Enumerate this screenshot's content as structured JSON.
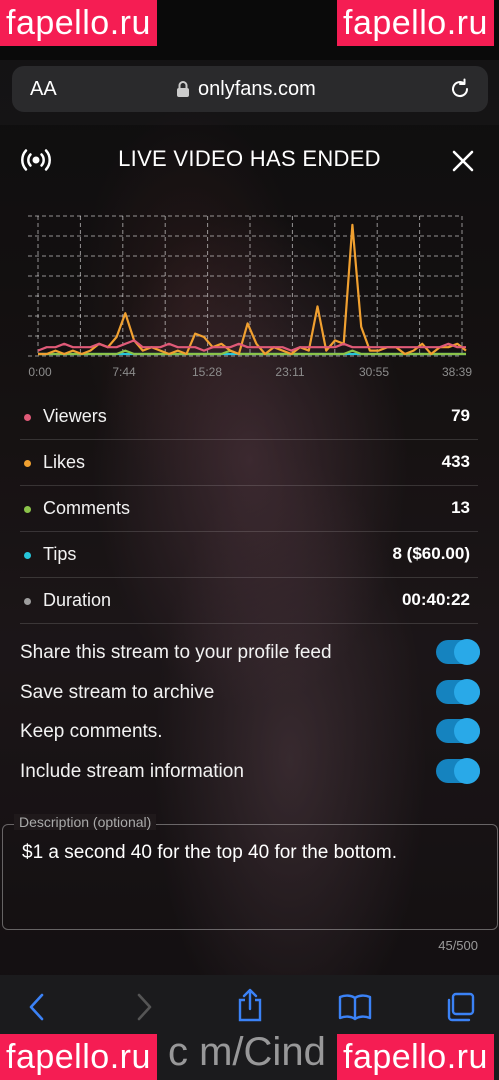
{
  "watermark": {
    "text": "fapello.ru"
  },
  "browser": {
    "aa_label": "AA",
    "url": "onlyfans.com",
    "bottom_url_fragment": "c m/Cind"
  },
  "modal": {
    "title": "LIVE VIDEO HAS ENDED"
  },
  "chart_data": {
    "type": "line",
    "x_tick_labels": [
      "0:00",
      "7:44",
      "15:28",
      "23:11",
      "30:55",
      "38:39"
    ],
    "grid": true,
    "series": [
      {
        "name": "Viewers",
        "color": "#e05a78",
        "values": [
          1,
          2,
          2,
          3,
          2,
          2,
          2,
          3,
          2,
          2,
          3,
          4,
          2,
          2,
          2,
          3,
          2,
          2,
          2,
          1,
          2,
          2,
          2,
          3,
          2,
          2,
          2,
          2,
          2,
          1,
          2,
          2,
          2,
          2,
          2,
          3,
          2,
          2,
          2,
          2,
          2,
          2,
          2,
          2,
          2,
          2,
          2,
          3,
          2,
          2
        ]
      },
      {
        "name": "Likes",
        "color": "#f0a030",
        "values": [
          0,
          0,
          1,
          0,
          1,
          0,
          1,
          3,
          2,
          5,
          12,
          4,
          1,
          2,
          1,
          0,
          1,
          0,
          6,
          5,
          2,
          3,
          1,
          0,
          9,
          3,
          0,
          2,
          1,
          0,
          2,
          1,
          14,
          1,
          4,
          3,
          38,
          8,
          1,
          1,
          2,
          2,
          0,
          1,
          3,
          0,
          2,
          2,
          3,
          1
        ]
      },
      {
        "name": "Comments",
        "color": "#8bc34a",
        "values": [
          0,
          0,
          0,
          0,
          0,
          0,
          0,
          0,
          0,
          0,
          1,
          0,
          0,
          0,
          0,
          0,
          0,
          0,
          0,
          0,
          0,
          0,
          1,
          0,
          0,
          0,
          0,
          0,
          0,
          0,
          0,
          0,
          0,
          0,
          0,
          0,
          1,
          0,
          0,
          0,
          0,
          0,
          0,
          0,
          0,
          0,
          0,
          0,
          0,
          0
        ]
      },
      {
        "name": "Tips",
        "color": "#26c6da",
        "values": [
          0,
          0,
          0,
          0,
          0,
          0,
          0,
          0,
          0,
          0,
          0,
          0,
          0,
          0,
          0,
          0,
          0,
          0,
          0,
          0,
          0,
          0,
          0,
          0,
          0,
          0,
          0,
          0,
          0,
          0,
          0,
          0,
          0,
          0,
          0,
          0,
          0,
          0,
          0,
          0,
          0,
          0,
          0,
          0,
          0,
          0,
          0,
          0,
          0,
          0
        ]
      }
    ]
  },
  "stats": [
    {
      "label": "Viewers",
      "value": "79",
      "color": "#e05a78"
    },
    {
      "label": "Likes",
      "value": "433",
      "color": "#f0a030"
    },
    {
      "label": "Comments",
      "value": "13",
      "color": "#8bc34a"
    },
    {
      "label": "Tips",
      "value": "8 ($60.00)",
      "color": "#26c6da"
    },
    {
      "label": "Duration",
      "value": "00:40:22",
      "color": "#9e9e9e"
    }
  ],
  "options": [
    {
      "label": "Share this stream to your profile feed",
      "on": true
    },
    {
      "label": "Save stream to archive",
      "on": true
    },
    {
      "label": "Keep comments.",
      "on": true
    },
    {
      "label": "Include stream information",
      "on": true
    }
  ],
  "description": {
    "legend": "Description (optional)",
    "text": "$1 a second 40 for the top 40 for the bottom.",
    "counter": "45/500"
  },
  "colors": {
    "accent": "#29a9e8",
    "brand_watermark": "#f51d53"
  },
  "icons": [
    "live-broadcast-icon",
    "close-icon",
    "lock-icon",
    "reload-icon",
    "back-icon",
    "forward-icon",
    "share-icon",
    "bookmarks-icon",
    "tabs-icon"
  ]
}
